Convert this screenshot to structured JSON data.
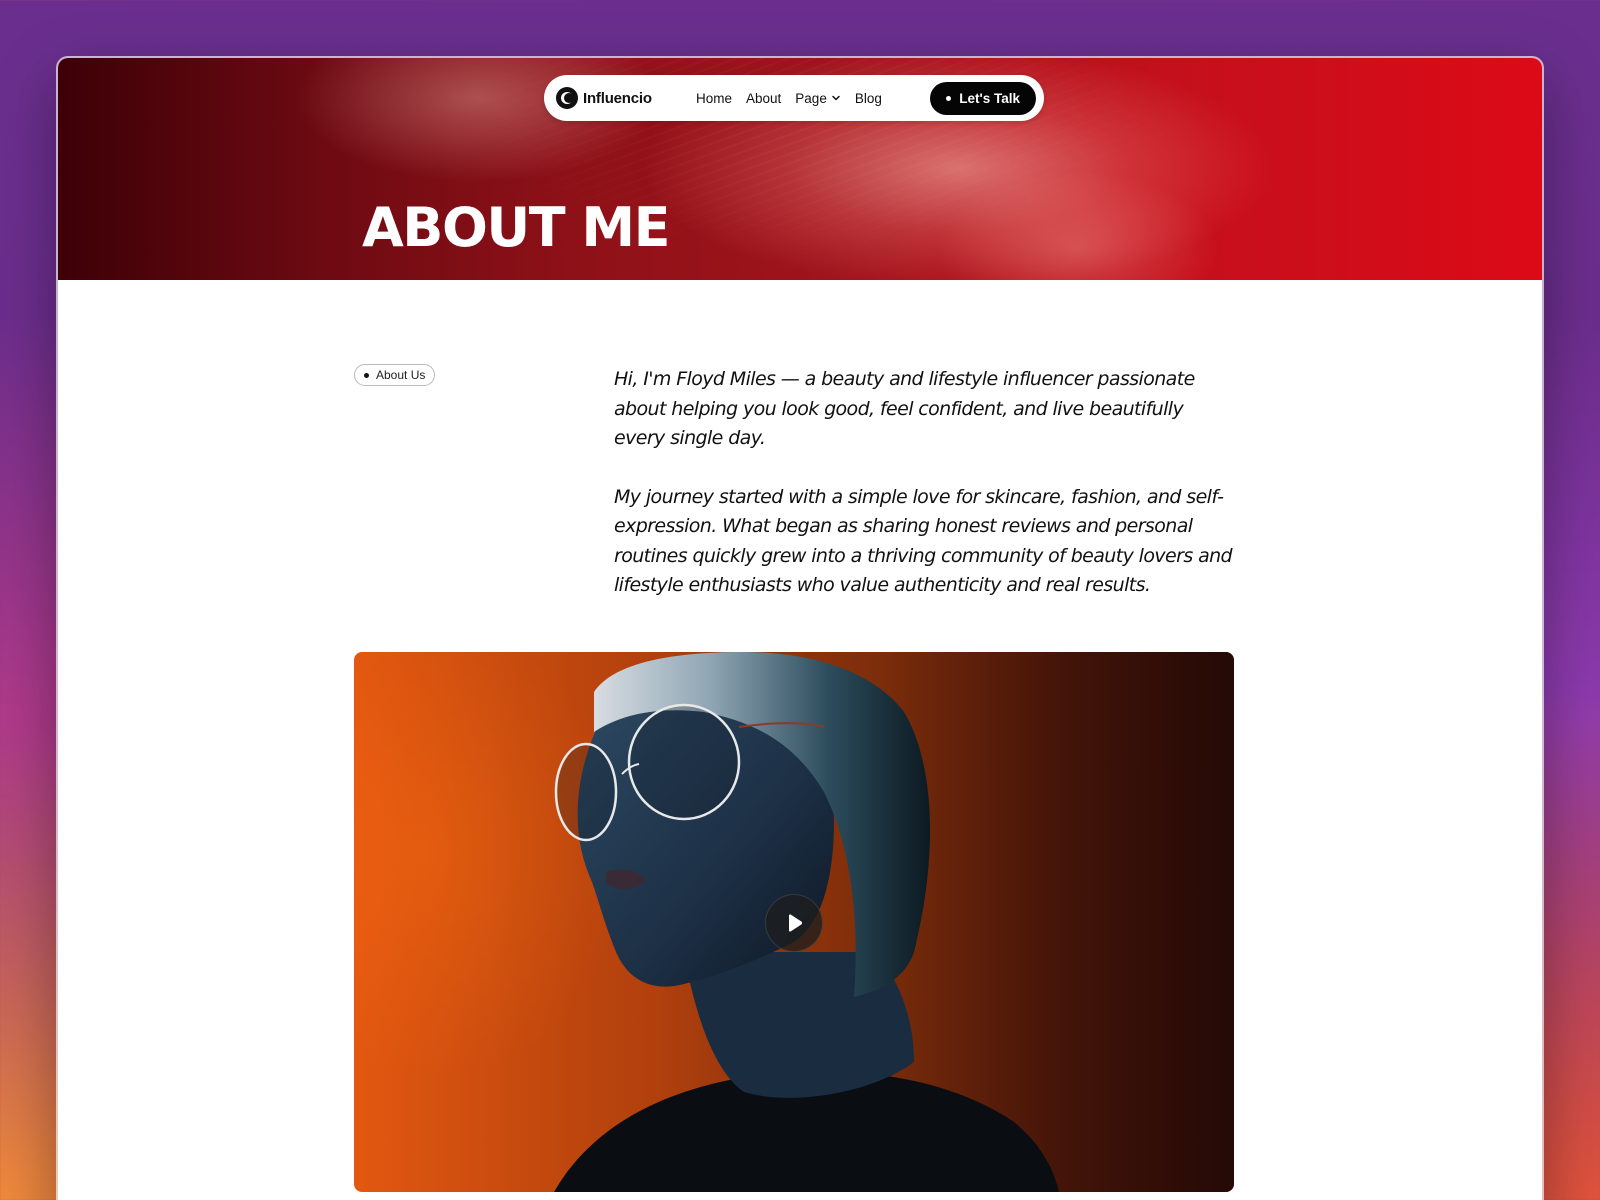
{
  "nav": {
    "brand": "Influencio",
    "links": [
      "Home",
      "About",
      "Page",
      "Blog"
    ],
    "cta_label": "Let's Talk"
  },
  "hero": {
    "title": "ABOUT ME"
  },
  "section": {
    "tag": "About Us",
    "paragraphs": [
      "Hi, I'm Floyd Miles — a beauty and lifestyle influencer passionate about helping you look good, feel confident, and live beautifully every single day.",
      "My journey started with a simple love for skincare, fashion, and self-expression. What began as sharing honest reviews and personal routines quickly grew into a thriving community of beauty lovers and lifestyle enthusiasts who value authenticity and real results."
    ]
  },
  "video": {
    "play_icon": "play-icon"
  },
  "colors": {
    "hero_red": "#dc0a17",
    "hero_dark": "#3d0007",
    "video_orange": "#e35810",
    "cta_black": "#050505"
  }
}
